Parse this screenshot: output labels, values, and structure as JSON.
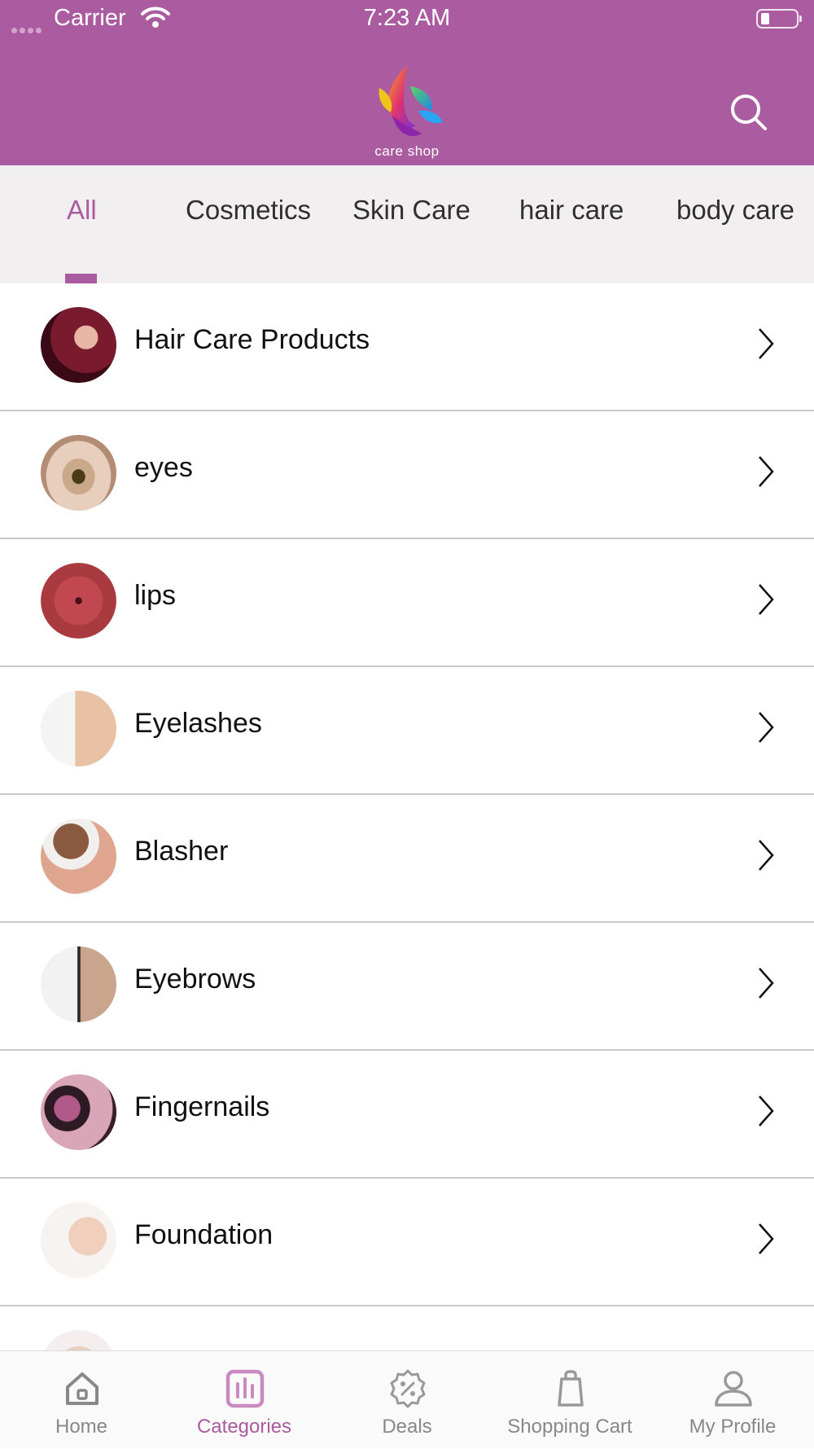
{
  "status_bar": {
    "carrier": "Carrier",
    "time": "7:23 AM"
  },
  "header": {
    "logo_text": "care shop",
    "brand_color": "#ab5b9f",
    "search_icon": "search-icon"
  },
  "tabs": [
    {
      "label": "All",
      "active": true
    },
    {
      "label": "Cosmetics",
      "active": false
    },
    {
      "label": "Skin Care",
      "active": false
    },
    {
      "label": "hair care",
      "active": false
    },
    {
      "label": "body care",
      "active": false
    }
  ],
  "categories": [
    {
      "label": "Hair Care Products"
    },
    {
      "label": "eyes"
    },
    {
      "label": "lips"
    },
    {
      "label": "Eyelashes"
    },
    {
      "label": "Blasher"
    },
    {
      "label": "Eyebrows"
    },
    {
      "label": "Fingernails"
    },
    {
      "label": "Foundation"
    },
    {
      "label": ""
    }
  ],
  "bottom_nav": [
    {
      "label": "Home",
      "icon": "home-icon",
      "active": false
    },
    {
      "label": "Categories",
      "icon": "categories-icon",
      "active": true
    },
    {
      "label": "Deals",
      "icon": "deals-icon",
      "active": false
    },
    {
      "label": "Shopping Cart",
      "icon": "shopping-bag-icon",
      "active": false
    },
    {
      "label": "My Profile",
      "icon": "profile-icon",
      "active": false
    }
  ],
  "colors": {
    "accent": "#ab5b9f",
    "tab_bar_bg": "#f1eff0",
    "inactive_nav": "#888888"
  }
}
